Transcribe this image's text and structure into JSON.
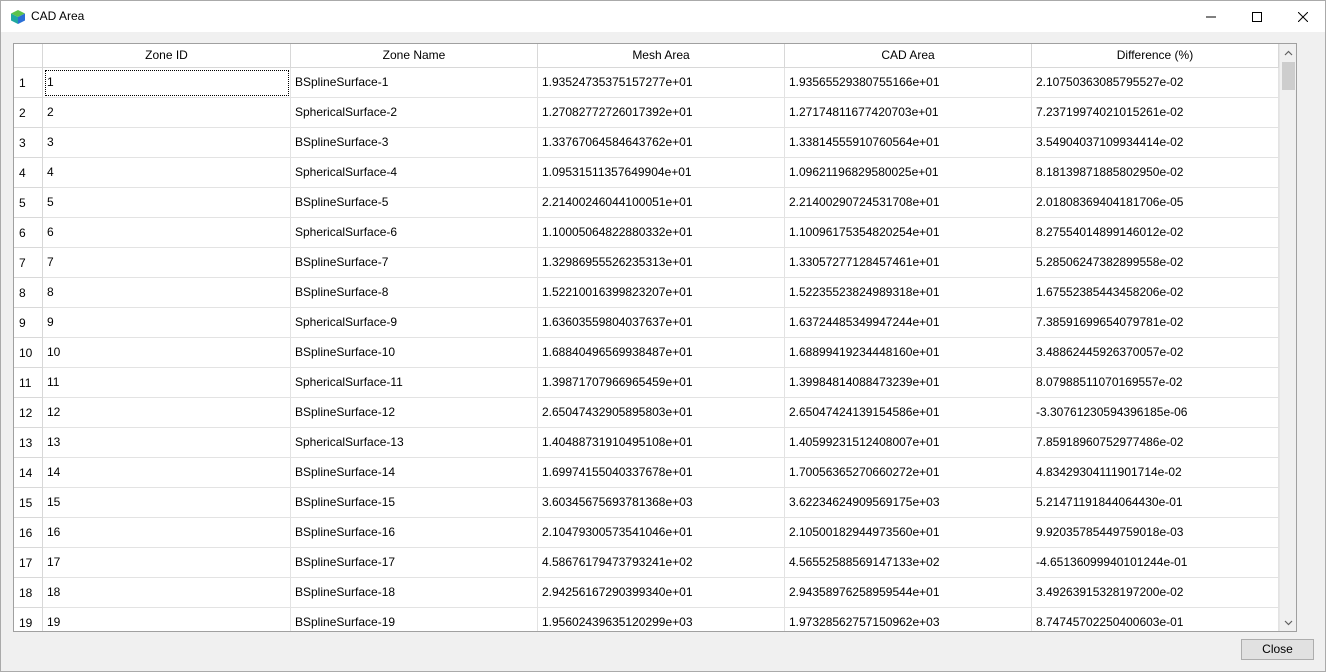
{
  "window": {
    "title": "CAD Area",
    "icon": "cube-icon"
  },
  "table": {
    "columns": [
      "Zone ID",
      "Zone Name",
      "Mesh Area",
      "CAD Area",
      "Difference (%)"
    ],
    "rows": [
      {
        "row_label": "1",
        "cells": [
          "1",
          "BSplineSurface-1",
          "1.93524735375157277e+01",
          "1.93565529380755166e+01",
          "2.10750363085795527e-02"
        ]
      },
      {
        "row_label": "2",
        "cells": [
          "2",
          "SphericalSurface-2",
          "1.27082772726017392e+01",
          "1.27174811677420703e+01",
          "7.23719974021015261e-02"
        ]
      },
      {
        "row_label": "3",
        "cells": [
          "3",
          "BSplineSurface-3",
          "1.33767064584643762e+01",
          "1.33814555910760564e+01",
          "3.54904037109934414e-02"
        ]
      },
      {
        "row_label": "4",
        "cells": [
          "4",
          "SphericalSurface-4",
          "1.09531511357649904e+01",
          "1.09621196829580025e+01",
          "8.18139871885802950e-02"
        ]
      },
      {
        "row_label": "5",
        "cells": [
          "5",
          "BSplineSurface-5",
          "2.21400246044100051e+01",
          "2.21400290724531708e+01",
          "2.01808369404181706e-05"
        ]
      },
      {
        "row_label": "6",
        "cells": [
          "6",
          "SphericalSurface-6",
          "1.10005064822880332e+01",
          "1.10096175354820254e+01",
          "8.27554014899146012e-02"
        ]
      },
      {
        "row_label": "7",
        "cells": [
          "7",
          "BSplineSurface-7",
          "1.32986955526235313e+01",
          "1.33057277128457461e+01",
          "5.28506247382899558e-02"
        ]
      },
      {
        "row_label": "8",
        "cells": [
          "8",
          "BSplineSurface-8",
          "1.52210016399823207e+01",
          "1.52235523824989318e+01",
          "1.67552385443458206e-02"
        ]
      },
      {
        "row_label": "9",
        "cells": [
          "9",
          "SphericalSurface-9",
          "1.63603559804037637e+01",
          "1.63724485349947244e+01",
          "7.38591699654079781e-02"
        ]
      },
      {
        "row_label": "10",
        "cells": [
          "10",
          "BSplineSurface-10",
          "1.68840496569938487e+01",
          "1.68899419234448160e+01",
          "3.48862445926370057e-02"
        ]
      },
      {
        "row_label": "11",
        "cells": [
          "11",
          "SphericalSurface-11",
          "1.39871707966965459e+01",
          "1.39984814088473239e+01",
          "8.07988511070169557e-02"
        ]
      },
      {
        "row_label": "12",
        "cells": [
          "12",
          "BSplineSurface-12",
          "2.65047432905895803e+01",
          "2.65047424139154586e+01",
          "-3.30761230594396185e-06"
        ]
      },
      {
        "row_label": "13",
        "cells": [
          "13",
          "SphericalSurface-13",
          "1.40488731910495108e+01",
          "1.40599231512408007e+01",
          "7.85918960752977486e-02"
        ]
      },
      {
        "row_label": "14",
        "cells": [
          "14",
          "BSplineSurface-14",
          "1.69974155040337678e+01",
          "1.70056365270660272e+01",
          "4.83429304111901714e-02"
        ]
      },
      {
        "row_label": "15",
        "cells": [
          "15",
          "BSplineSurface-15",
          "3.60345675693781368e+03",
          "3.62234624909569175e+03",
          "5.21471191844064430e-01"
        ]
      },
      {
        "row_label": "16",
        "cells": [
          "16",
          "BSplineSurface-16",
          "2.10479300573541046e+01",
          "2.10500182944973560e+01",
          "9.92035785449759018e-03"
        ]
      },
      {
        "row_label": "17",
        "cells": [
          "17",
          "BSplineSurface-17",
          "4.58676179473793241e+02",
          "4.56552588569147133e+02",
          "-4.65136099940101244e-01"
        ]
      },
      {
        "row_label": "18",
        "cells": [
          "18",
          "BSplineSurface-18",
          "2.94256167290399340e+01",
          "2.94358976258959544e+01",
          "3.49263915328197200e-02"
        ]
      },
      {
        "row_label": "19",
        "cells": [
          "19",
          "BSplineSurface-19",
          "1.95602439635120299e+03",
          "1.97328562757150962e+03",
          "8.74745702250400603e-01"
        ]
      }
    ]
  },
  "footer": {
    "close_label": "Close"
  },
  "colors": {
    "accent_icon_teal": "#1fa8a0",
    "accent_icon_green": "#5cc24a",
    "accent_icon_blue": "#2a6fd6"
  }
}
